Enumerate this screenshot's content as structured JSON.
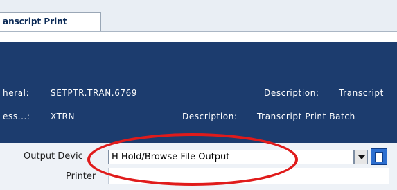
{
  "tab": {
    "label": "anscript Print"
  },
  "header": {
    "peripheral_label": "heral:",
    "peripheral_value": "SETPTR.TRAN.6769",
    "description1_label": "Description:",
    "description1_value": "Transcript",
    "process_label": "ess...:",
    "process_value": "XTRN",
    "description2_label": "Description:",
    "description2_value": "Transcript Print Batch"
  },
  "form": {
    "output_device_label": "Output Devic",
    "output_device_value": "H Hold/Browse File Output",
    "printer_label": "Printer",
    "printer_value": ""
  },
  "colors": {
    "header_bg": "#1c3c6e",
    "annotation": "#e01b1b",
    "lookup_button": "#2d6fd0"
  },
  "icons": {
    "dropdown": "chevron-down-icon",
    "lookup": "lookup-icon"
  }
}
